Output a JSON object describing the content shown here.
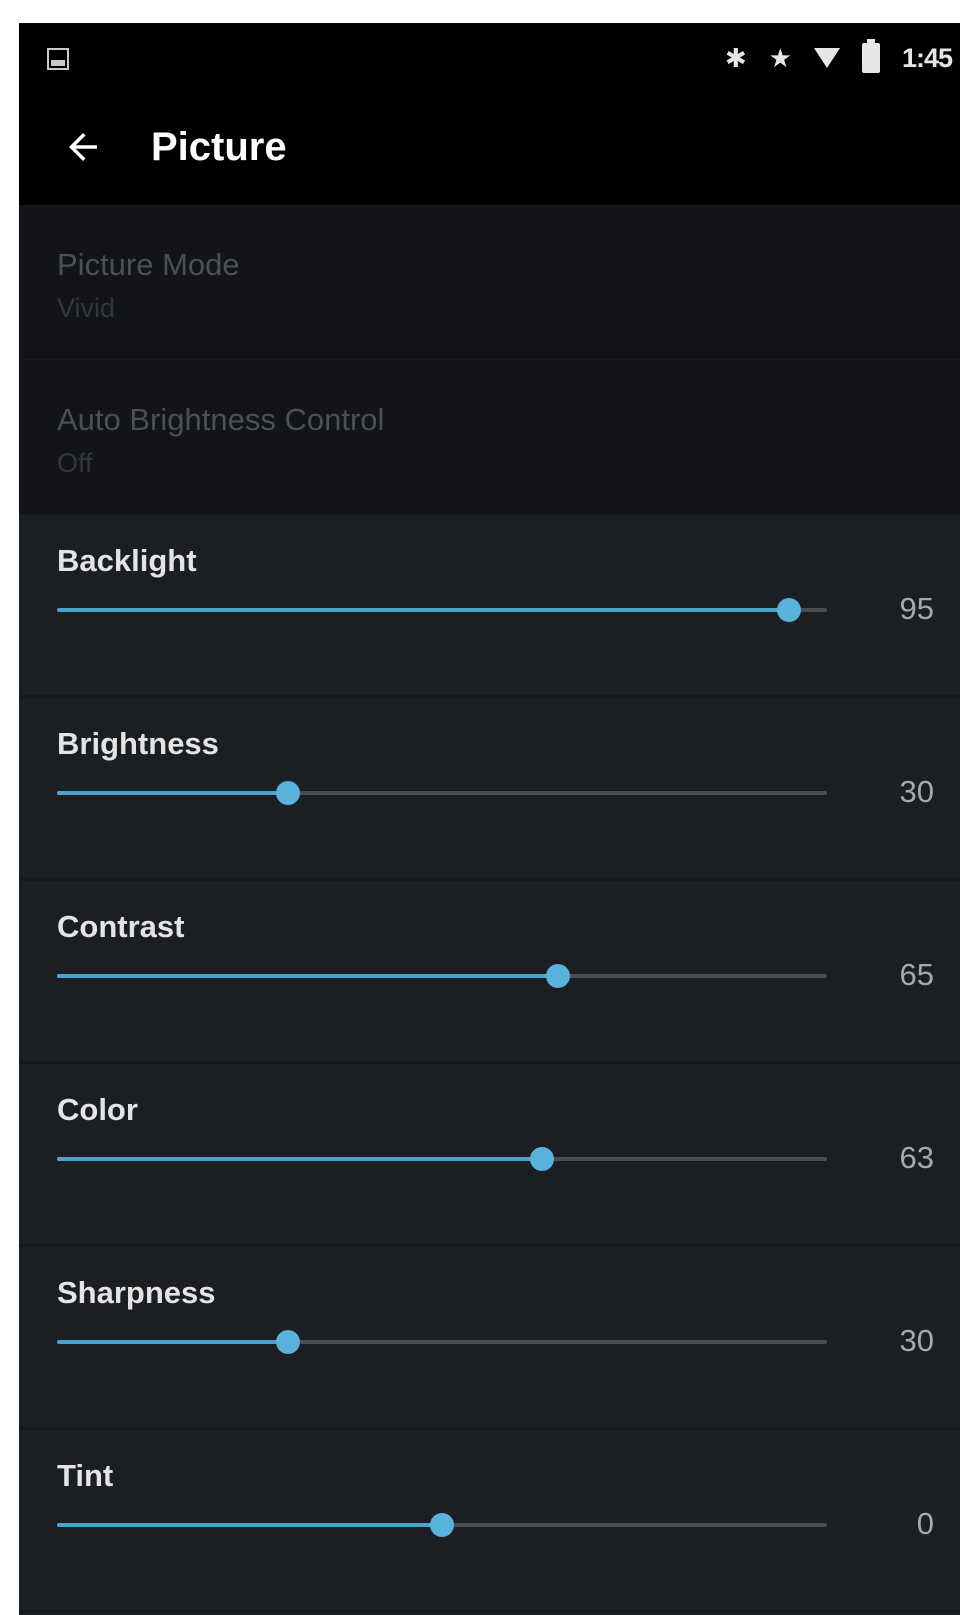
{
  "status_bar": {
    "left_icon": "image-notification-icon",
    "icons": [
      "bluetooth-icon",
      "star-icon",
      "wifi-icon",
      "battery-icon"
    ],
    "time": "1:45"
  },
  "app_bar": {
    "back_icon": "arrow-left-icon",
    "title": "Picture"
  },
  "disabled_items": [
    {
      "title": "Picture Mode",
      "value": "Vivid"
    },
    {
      "title": "Auto Brightness Control",
      "value": "Off"
    }
  ],
  "sliders": [
    {
      "label": "Backlight",
      "value": "95",
      "level": 0.95
    },
    {
      "label": "Brightness",
      "value": "30",
      "level": 0.3
    },
    {
      "label": "Contrast",
      "value": "65",
      "level": 0.65
    },
    {
      "label": "Color",
      "value": "63",
      "level": 0.63
    },
    {
      "label": "Sharpness",
      "value": "30",
      "level": 0.3
    },
    {
      "label": "Tint",
      "value": "0",
      "level": 0.5
    }
  ],
  "colors": {
    "accent": "#4aa4cf",
    "thumb": "#59b2dc",
    "background": "#1b1e22",
    "bar": "#000000"
  }
}
